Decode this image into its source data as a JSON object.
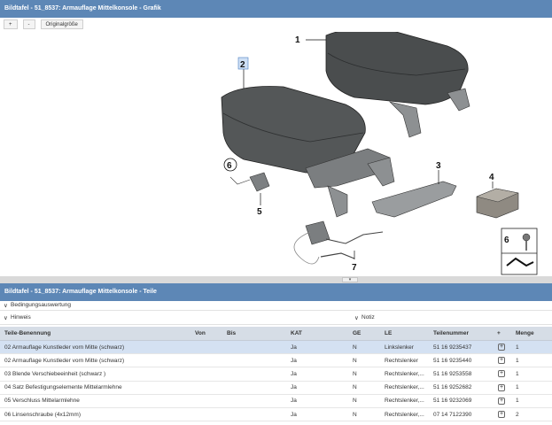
{
  "graphic_panel": {
    "title": "Bildtafel - 51_8537: Armauflage Mittelkonsole - Grafik",
    "toolbar": {
      "zoom_in": "+",
      "zoom_out": "-",
      "original_size": "Originalgröße"
    },
    "callouts": [
      "1",
      "2",
      "3",
      "4",
      "5",
      "6",
      "7"
    ]
  },
  "parts_panel": {
    "title": "Bildtafel - 51_8537: Armauflage Mittelkonsole - Teile",
    "conditions_label": "Bedingungsauswertung",
    "hint_label": "Hinweis",
    "note_label": "Notiz",
    "columns": [
      "Teile-Benennung",
      "Von",
      "Bis",
      "KAT",
      "GE",
      "LE",
      "Teilenummer",
      "+",
      "Menge"
    ],
    "rows": [
      {
        "name": "02 Armauflage Kunstleder vorn Mitte (schwarz)",
        "from": "",
        "to": "",
        "kat": "Ja",
        "ge": "N",
        "le": "Linkslenker",
        "part_no": "51 16 9235437",
        "qty": "1"
      },
      {
        "name": "02 Armauflage Kunstleder vorn Mitte (schwarz)",
        "from": "",
        "to": "",
        "kat": "Ja",
        "ge": "N",
        "le": "Rechtslenker",
        "part_no": "51 16 9235440",
        "qty": "1"
      },
      {
        "name": "03 Blende Verschiebeeinheit (schwarz )",
        "from": "",
        "to": "",
        "kat": "Ja",
        "ge": "N",
        "le": "Rechtslenker,...",
        "part_no": "51 16 9253558",
        "qty": "1"
      },
      {
        "name": "04 Satz Befestigungselemente Mittelarmlehne",
        "from": "",
        "to": "",
        "kat": "Ja",
        "ge": "N",
        "le": "Rechtslenker,...",
        "part_no": "51 16 9252682",
        "qty": "1"
      },
      {
        "name": "05 Verschluss Mittelarmlehne",
        "from": "",
        "to": "",
        "kat": "Ja",
        "ge": "N",
        "le": "Rechtslenker,...",
        "part_no": "51 16 9232069",
        "qty": "1"
      },
      {
        "name": "06 Linsenschraube (4x12mm)",
        "from": "",
        "to": "",
        "kat": "Ja",
        "ge": "N",
        "le": "Rechtslenker,...",
        "part_no": "07 14 7122390",
        "qty": "2"
      }
    ]
  }
}
